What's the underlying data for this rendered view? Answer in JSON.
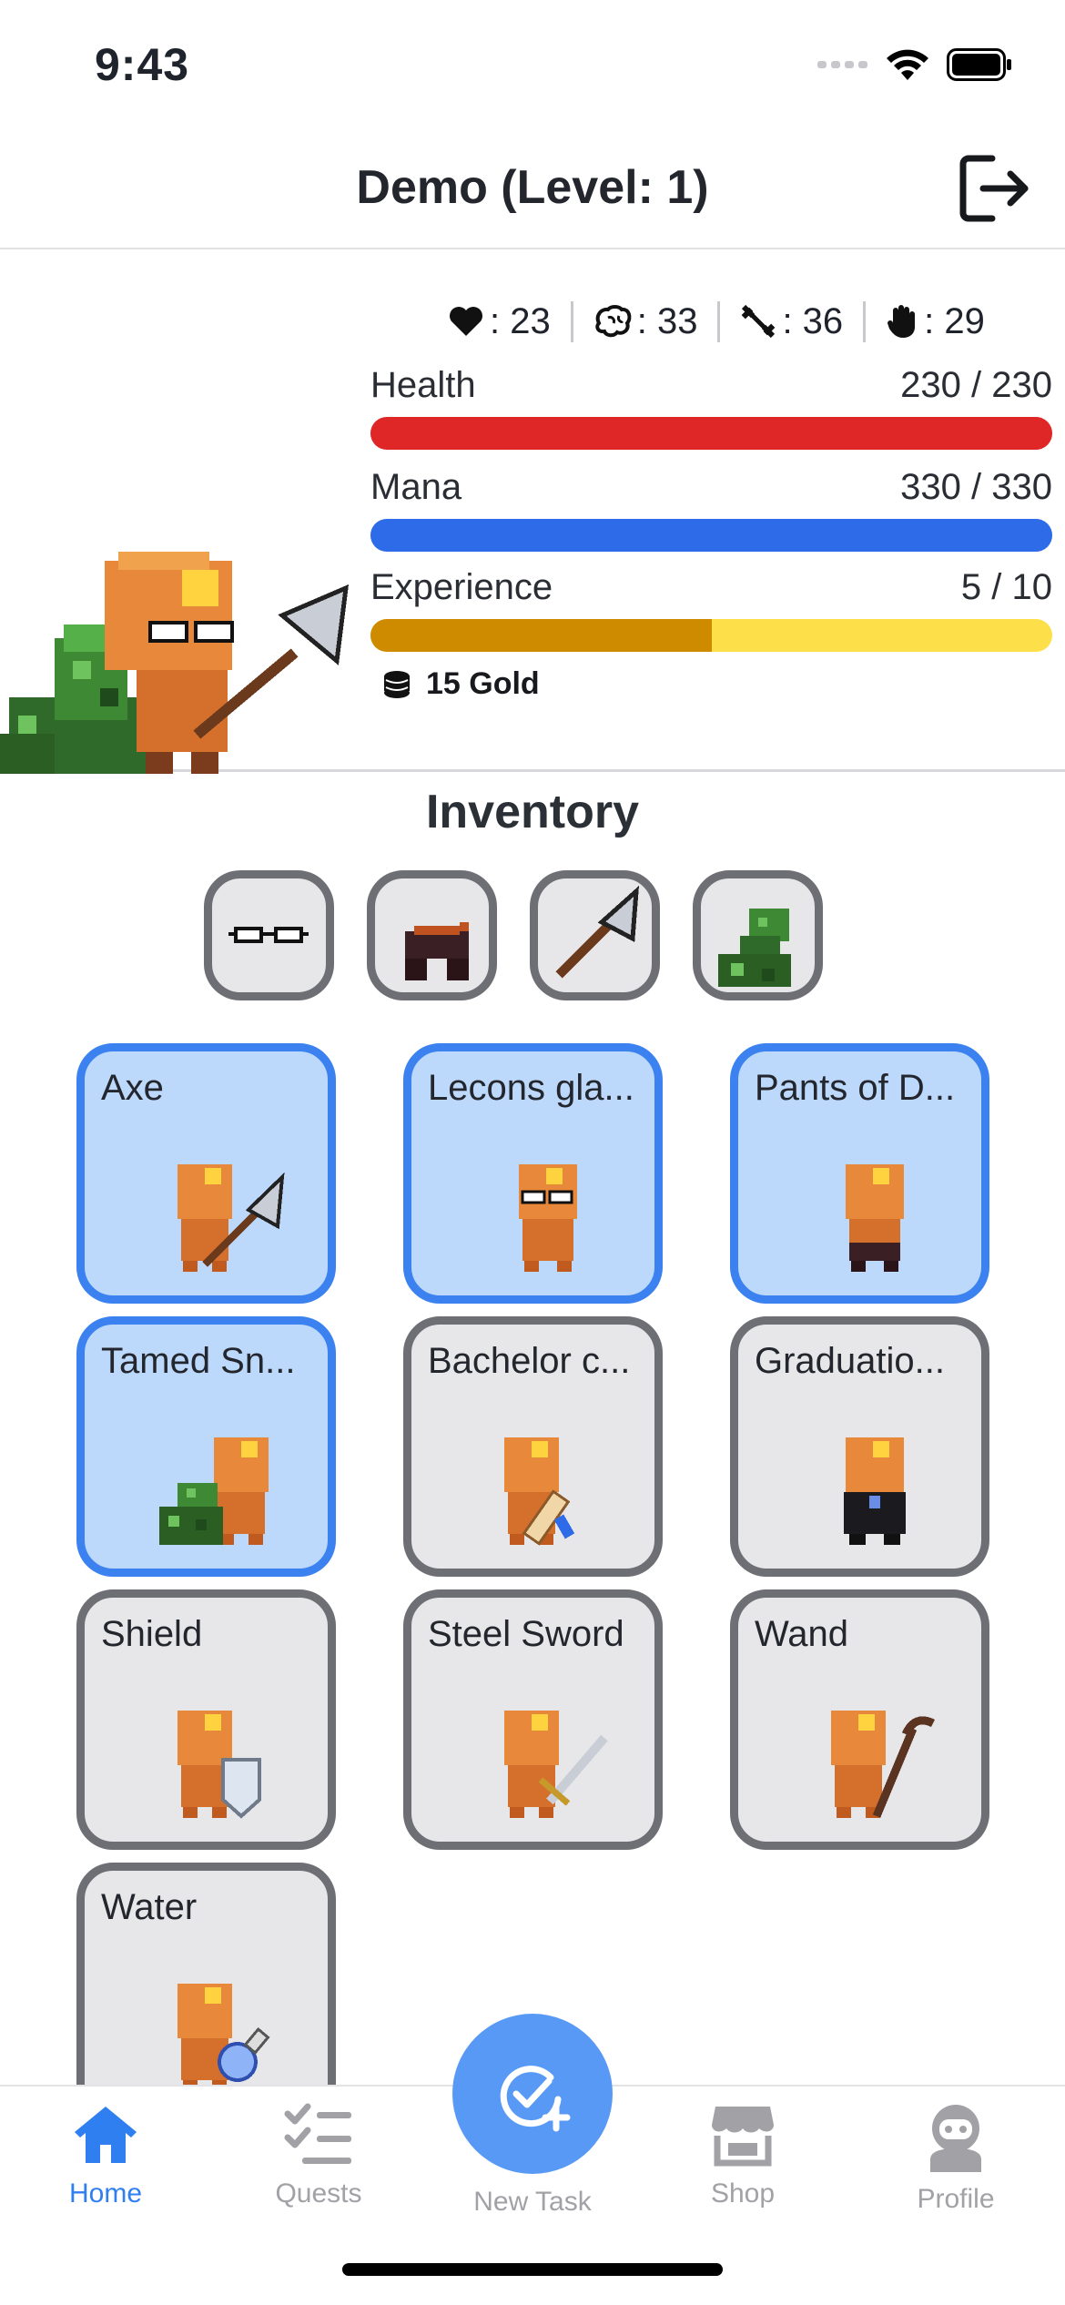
{
  "status_bar": {
    "time": "9:43"
  },
  "header": {
    "title": "Demo (Level: 1)"
  },
  "stats": [
    {
      "icon": "heart-icon",
      "value": ": 23"
    },
    {
      "icon": "brain-icon",
      "value": ": 33"
    },
    {
      "icon": "dumbbell-icon",
      "value": ": 36"
    },
    {
      "icon": "hand-icon",
      "value": ": 29"
    }
  ],
  "bars": {
    "health": {
      "label": "Health",
      "value": "230 / 230",
      "fraction": 1.0,
      "color": "#e02727"
    },
    "mana": {
      "label": "Mana",
      "value": "330 / 330",
      "fraction": 1.0,
      "color": "#2d6be8"
    },
    "experience": {
      "label": "Experience",
      "value": "5 / 10",
      "fraction": 0.5,
      "color": "#cf8b00",
      "track": "#fde049"
    }
  },
  "gold": {
    "text": "15 Gold"
  },
  "inventory": {
    "title": "Inventory",
    "items": [
      {
        "label": "Axe",
        "selected": true
      },
      {
        "label": "Lecons gla...",
        "selected": true
      },
      {
        "label": "Pants of D...",
        "selected": true
      },
      {
        "label": "Tamed Sn...",
        "selected": true
      },
      {
        "label": "Bachelor c...",
        "selected": false
      },
      {
        "label": "Graduatio...",
        "selected": false
      },
      {
        "label": "Shield",
        "selected": false
      },
      {
        "label": "Steel Sword",
        "selected": false
      },
      {
        "label": "Wand",
        "selected": false
      },
      {
        "label": "Water",
        "selected": false
      }
    ]
  },
  "tabs": {
    "home": "Home",
    "quests": "Quests",
    "new_task": "New Task",
    "shop": "Shop",
    "profile": "Profile"
  },
  "colors": {
    "accent": "#2f7ff0",
    "selected_border": "#3b82f0",
    "selected_bg": "#bcd8fb",
    "card_border": "#6e6e75",
    "card_bg": "#e7e7ea"
  }
}
